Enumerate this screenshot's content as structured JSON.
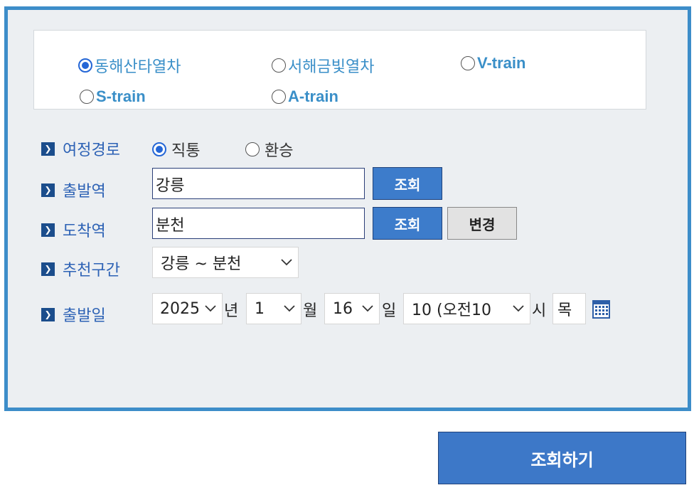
{
  "train_types": [
    {
      "label": "동해산타열차",
      "checked": true
    },
    {
      "label": "서해금빛열차",
      "checked": false
    },
    {
      "label": "V-train",
      "checked": false
    },
    {
      "label": "S-train",
      "checked": false
    },
    {
      "label": "A-train",
      "checked": false
    }
  ],
  "route": {
    "label": "여정경로",
    "options": [
      {
        "label": "직통",
        "checked": true
      },
      {
        "label": "환승",
        "checked": false
      }
    ]
  },
  "departure": {
    "label": "출발역",
    "value": "강릉",
    "search_label": "조회"
  },
  "arrival": {
    "label": "도착역",
    "value": "분천",
    "search_label": "조회",
    "swap_label": "변경"
  },
  "recommended": {
    "label": "추천구간",
    "value": "강릉 ~ 분천"
  },
  "date": {
    "label": "출발일",
    "year": "2025",
    "year_unit": "년",
    "month": "1",
    "month_unit": "월",
    "day": "16",
    "day_unit": "일",
    "hour": "10 (오전10",
    "hour_unit": "시",
    "weekday": "목"
  },
  "submit_label": "조회하기",
  "colors": {
    "panel_border": "#3d8dc9",
    "accent_blue": "#2466d6",
    "label_blue": "#2d62b5",
    "button_blue": "#3d7ccb"
  },
  "icons": {
    "row_marker": "chevron-right-icon",
    "calendar": "calendar-icon"
  }
}
